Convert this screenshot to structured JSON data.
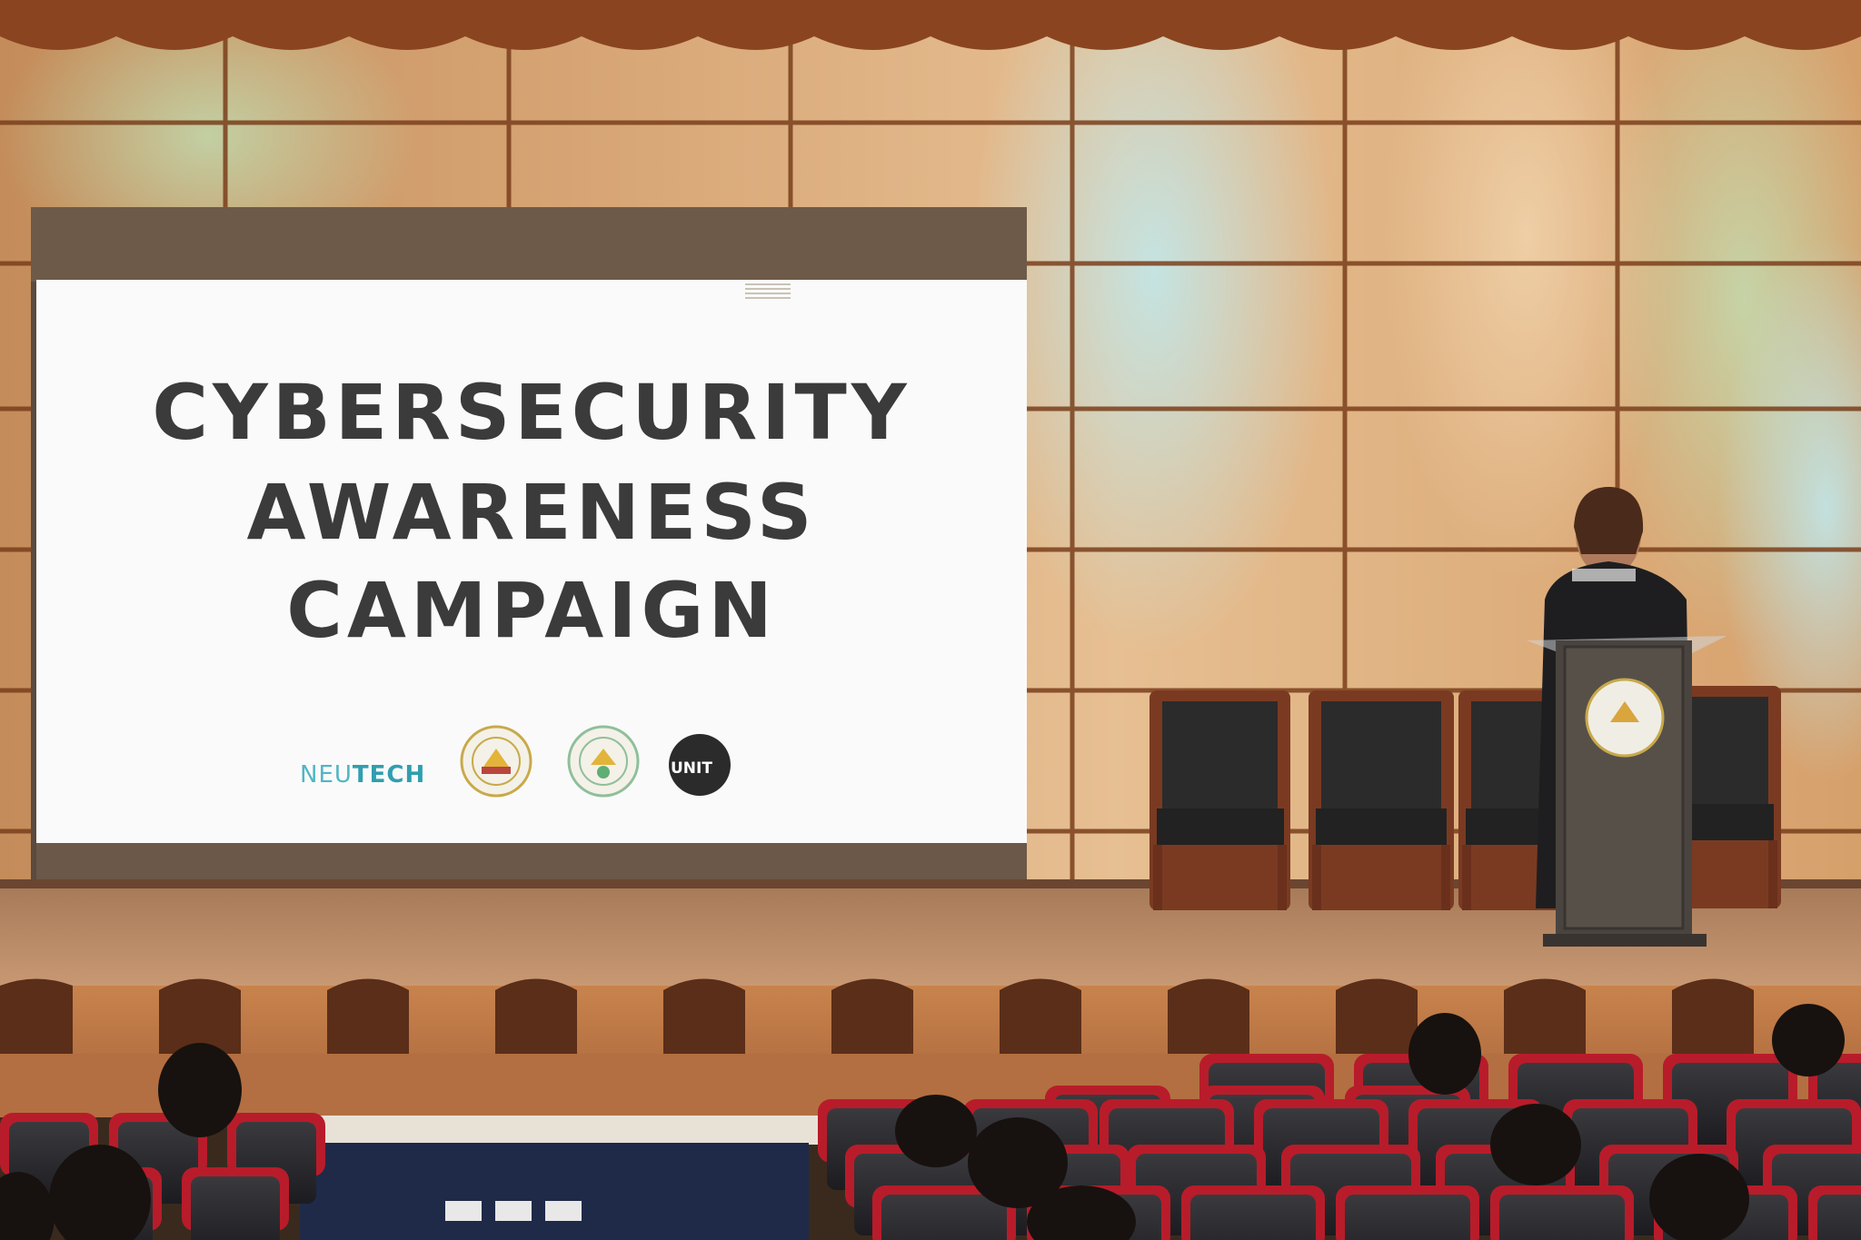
{
  "slide": {
    "title_line1": "CYBERSECURITY",
    "title_line2": "AWARENESS",
    "title_line3": "CAMPAIGN"
  },
  "logos": {
    "neutech_light": "NEU",
    "neutech_bold": "TECH",
    "unit_label": "UNIT"
  },
  "colors": {
    "wall": "#d9a571",
    "screen": "#fafafa",
    "screen_frame": "#6e5a49",
    "stage_floor": "#b98660",
    "seat_red": "#b81c2a",
    "chair_leather": "#2b2b2b",
    "podium": "#4a4440",
    "neutech_teal": "#4fb6c4"
  },
  "icons": [
    "neutech-logo",
    "university-seal-icon",
    "college-seal-icon",
    "unit-logo-icon"
  ]
}
